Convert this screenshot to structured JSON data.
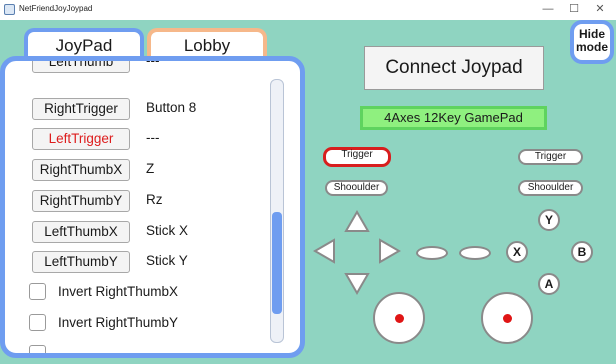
{
  "window": {
    "title": "NetFriendJoyJoypad",
    "controls": {
      "minimize": "—",
      "maximize": "☐",
      "close": "✕"
    }
  },
  "tabs": [
    {
      "label": "JoyPad"
    },
    {
      "label": "Lobby"
    }
  ],
  "mapping_rows": [
    {
      "button": "LeftThumb",
      "value": "---",
      "highlight": false
    },
    {
      "button": "RightTrigger",
      "value": "Button 8",
      "highlight": false
    },
    {
      "button": "LeftTrigger",
      "value": "---",
      "highlight": true
    },
    {
      "button": "RightThumbX",
      "value": "Z",
      "highlight": false
    },
    {
      "button": "RightThumbY",
      "value": "Rz",
      "highlight": false
    },
    {
      "button": "LeftThumbX",
      "value": "Stick X",
      "highlight": false
    },
    {
      "button": "LeftThumbY",
      "value": "Stick Y",
      "highlight": false
    }
  ],
  "checkboxes": [
    {
      "label": "Invert RightThumbX",
      "checked": false
    },
    {
      "label": "Invert RightThumbY",
      "checked": false
    }
  ],
  "connect_button": "Connect Joypad",
  "hide_button": {
    "line1": "Hide",
    "line2": "mode"
  },
  "gamepad_type": "4Axes 12Key GamePad",
  "gamepad": {
    "trigger_left": "Trigger",
    "trigger_right": "Trigger",
    "shoulder_left": "Shooulder",
    "shoulder_right": "Shooulder",
    "face": {
      "y": "Y",
      "x": "X",
      "b": "B",
      "a": "A"
    },
    "dpad_icons": [
      "arrow-up-icon",
      "arrow-left-icon",
      "arrow-right-icon",
      "arrow-down-icon"
    ]
  },
  "colors": {
    "background": "#8fd4c1",
    "accent_blue": "#6f9df0",
    "accent_orange": "#f6b88a",
    "status_green": "#8ff07f",
    "trigger_highlight": "#d81e1e",
    "stick_dot": "#e01515"
  }
}
